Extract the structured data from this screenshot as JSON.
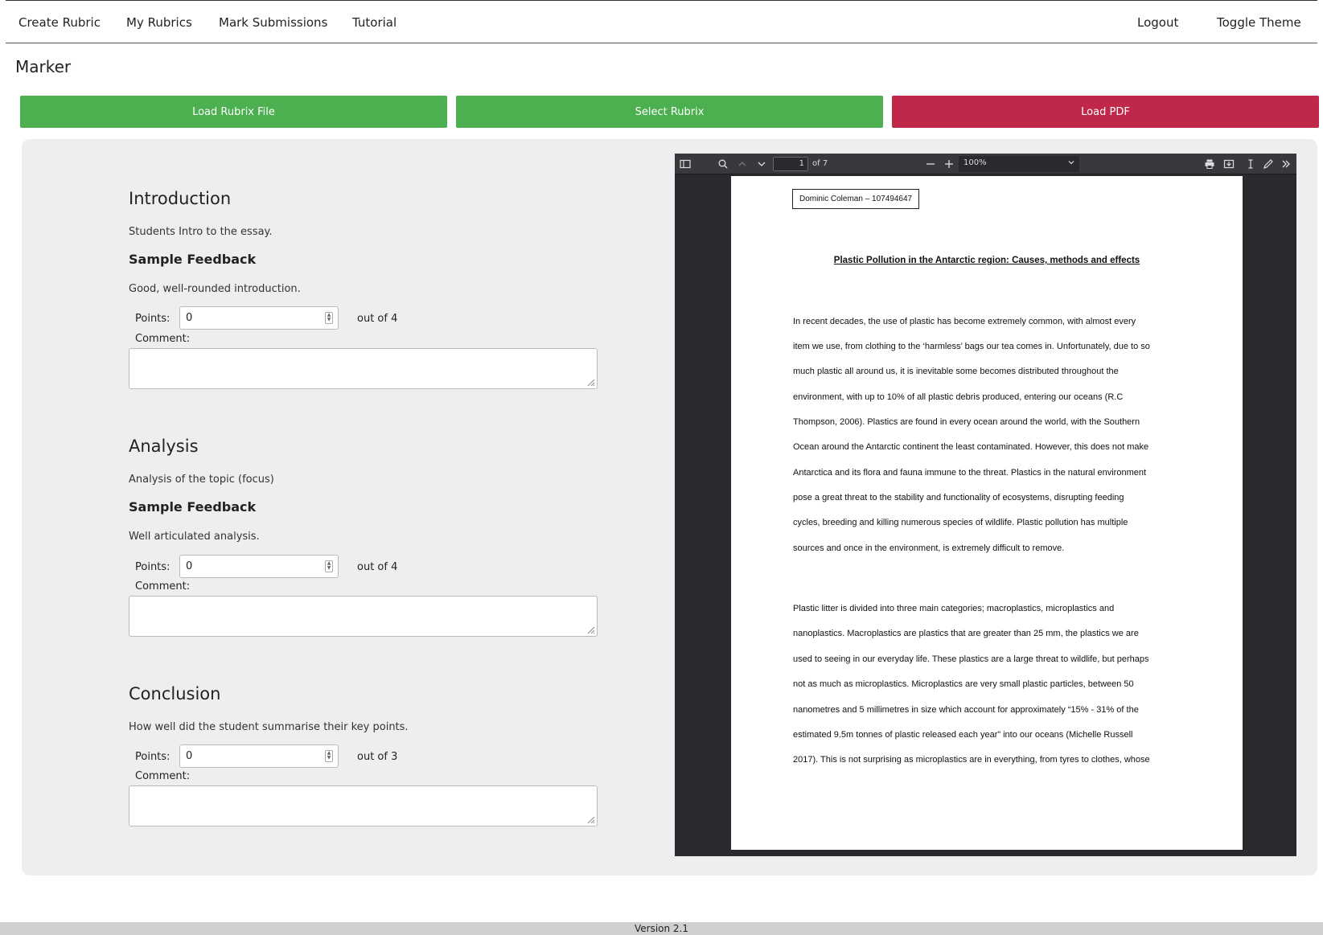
{
  "nav": {
    "create_rubric": "Create Rubric",
    "my_rubrics": "My Rubrics",
    "mark_submissions": "Mark Submissions",
    "tutorial": "Tutorial",
    "logout": "Logout",
    "toggle_theme": "Toggle Theme"
  },
  "page_title": "Marker",
  "buttons": {
    "load_rubrix_file": "Load Rubrix File",
    "select_rubrix": "Select Rubrix",
    "load_pdf": "Load PDF"
  },
  "colors": {
    "green_button": "#4caf50",
    "red_button": "#c0284a",
    "panel_bg": "#eeeeee"
  },
  "criteria": [
    {
      "title": "Introduction",
      "description": "Students Intro to the essay.",
      "feedback_title": "Sample Feedback",
      "feedback": "Good, well-rounded introduction.",
      "points_label": "Points:",
      "points_value": "0",
      "out_of": "out of 4",
      "comment_label": "Comment:"
    },
    {
      "title": "Analysis",
      "description": "Analysis of the topic (focus)",
      "feedback_title": "Sample Feedback",
      "feedback": "Well articulated analysis.",
      "points_label": "Points:",
      "points_value": "0",
      "out_of": "out of 4",
      "comment_label": "Comment:"
    },
    {
      "title": "Conclusion",
      "description": "How well did the student summarise their key points.",
      "points_label": "Points:",
      "points_value": "0",
      "out_of": "out of 3",
      "comment_label": "Comment:"
    }
  ],
  "pdf_viewer": {
    "page_number": "1",
    "page_count": "of 7",
    "zoom": "100%",
    "document": {
      "author": "Dominic Coleman – 107494647",
      "title": "Plastic Pollution in the Antarctic region: Causes, methods and effects",
      "paragraph1": [
        "In recent decades, the use of plastic has become extremely common, with almost every",
        "item we use, from clothing to the ‘harmless’ bags our tea comes in. Unfortunately, due to so",
        "much plastic all around us, it is inevitable some becomes distributed throughout the",
        "environment, with up to 10% of all plastic debris produced, entering our oceans (R.C",
        "Thompson, 2006). Plastics are found in every ocean around the world, with the Southern",
        "Ocean around the Antarctic continent the least contaminated. However, this does not make",
        "Antarctica and its flora and fauna immune to the threat. Plastics in the natural environment",
        "pose a great threat to the stability and functionality of ecosystems, disrupting feeding",
        "cycles, breeding and killing numerous species of wildlife. Plastic pollution has multiple",
        "sources and once in the environment, is extremely difficult to remove."
      ],
      "paragraph2": [
        "Plastic litter is divided into three main categories; macroplastics, microplastics and",
        "nanoplastics. Macroplastics are plastics that are greater than 25 mm, the plastics we are",
        "used to seeing in our everyday life. These plastics are a large threat to wildlife, but perhaps",
        "not as much as microplastics. Microplastics are very small plastic particles, between 50",
        "nanometres and 5 millimetres in size which account for approximately “15% - 31% of the",
        "estimated 9.5m tonnes of plastic released each year” into our oceans (Michelle Russell",
        "2017).  This is not surprising as microplastics are in everything, from tyres to clothes, whose"
      ]
    }
  },
  "footer": "Version 2.1"
}
